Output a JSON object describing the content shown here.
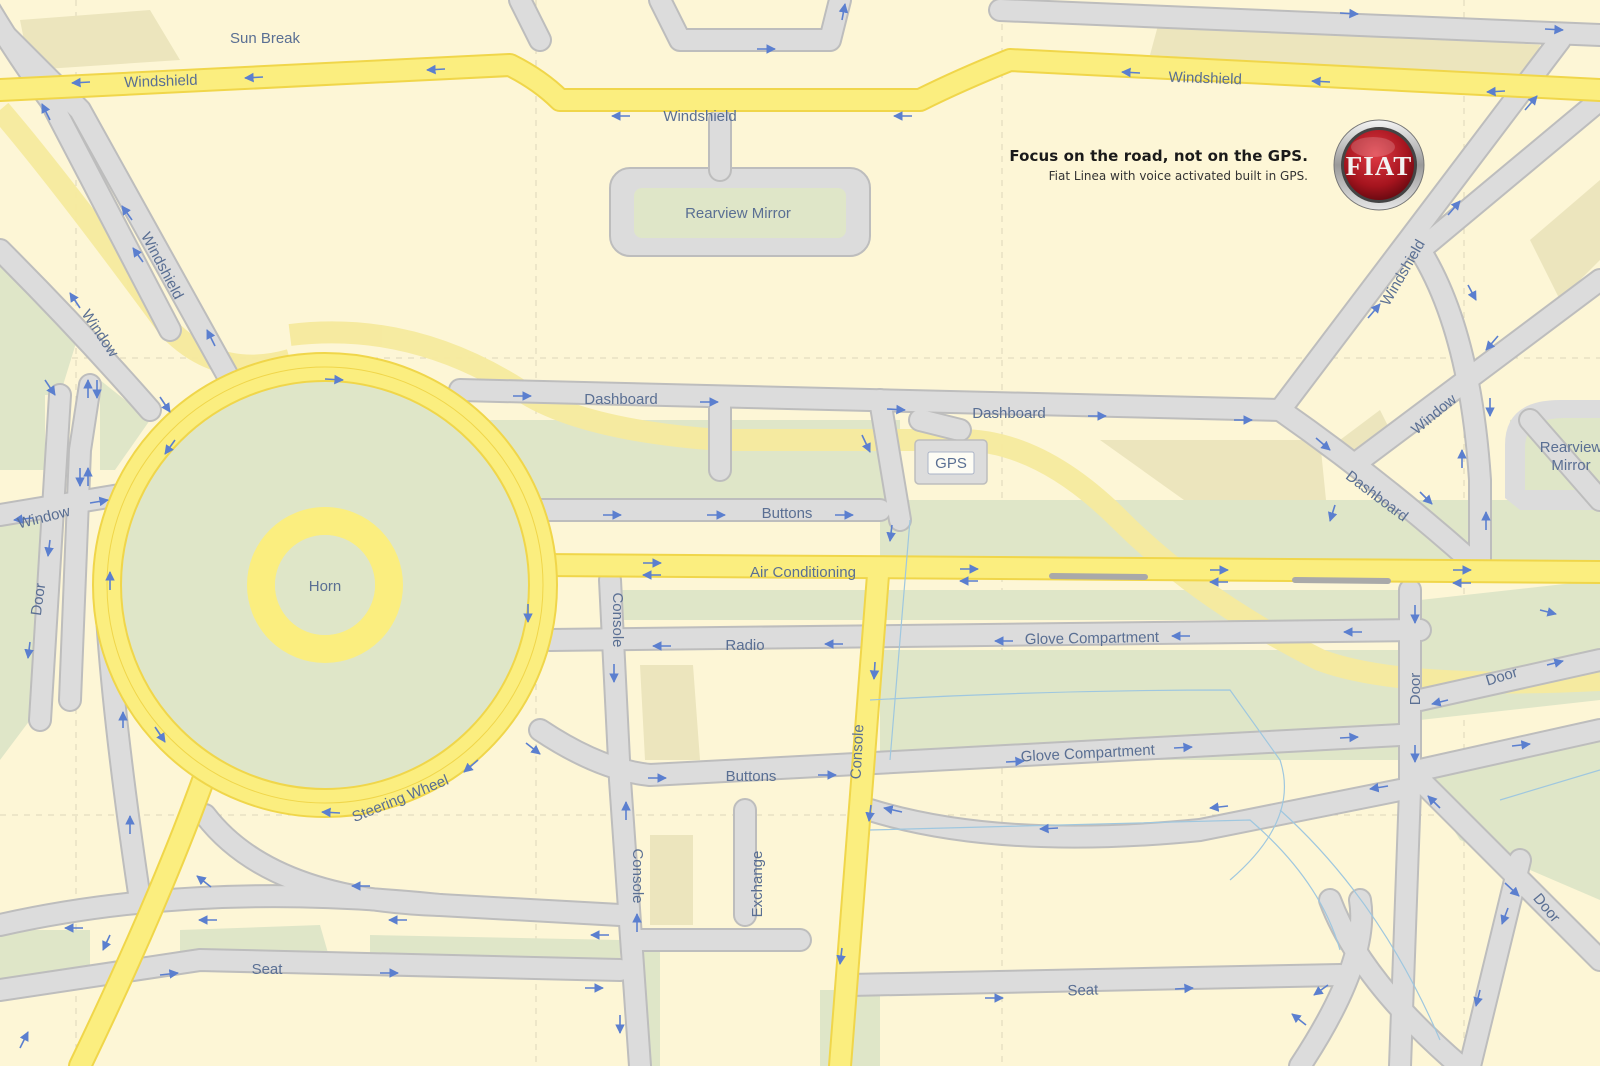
{
  "ad": {
    "headline": "Focus on the road, not on the GPS.",
    "subline": "Fiat Linea with voice activated built in GPS.",
    "brand_logo_text": "FIAT"
  },
  "colors": {
    "background": "#fdf6d6",
    "park": "#dfe6c8",
    "road": "#dcdcdc",
    "road_edge": "#bdbdbd",
    "highway": "#fbee7f",
    "highway_edge": "#f0d64a",
    "label": "#5a6f93",
    "arrow": "#5b7fcf",
    "brand_red": "#b51a25"
  },
  "map": {
    "areas": {
      "sun_break": "Sun Break",
      "rearview_mirror_center": "Rearview Mirror",
      "rearview_mirror_right": [
        "Rearview",
        "Mirror"
      ],
      "gps": "GPS",
      "horn": "Horn"
    },
    "roads": {
      "windshield_left": "Windshield",
      "windshield_mid": "Windshield",
      "windshield_right": "Windshield",
      "windshield_diag_left": "Windshield",
      "windshield_diag_right": "Windshield",
      "window_left": "Window",
      "window_left_lower": "Window",
      "window_right": "Window",
      "dashboard_left": "Dashboard",
      "dashboard_mid": "Dashboard",
      "dashboard_right": "Dashboard",
      "buttons_upper": "Buttons",
      "buttons_lower": "Buttons",
      "air_conditioning": "Air Conditioning",
      "console_upper": "Console",
      "console_mid": "Console",
      "console_lower": "Console",
      "radio": "Radio",
      "glove_compartment_upper": "Glove Compartment",
      "glove_compartment_lower": "Glove Compartment",
      "steering_wheel": "Steering Wheel",
      "door_left": "Door",
      "door_right_vertical": "Door",
      "door_right_upper": "Door",
      "door_right_lower": "Door",
      "exchange": "Exchange",
      "seat_left": "Seat",
      "seat_right": "Seat"
    }
  }
}
